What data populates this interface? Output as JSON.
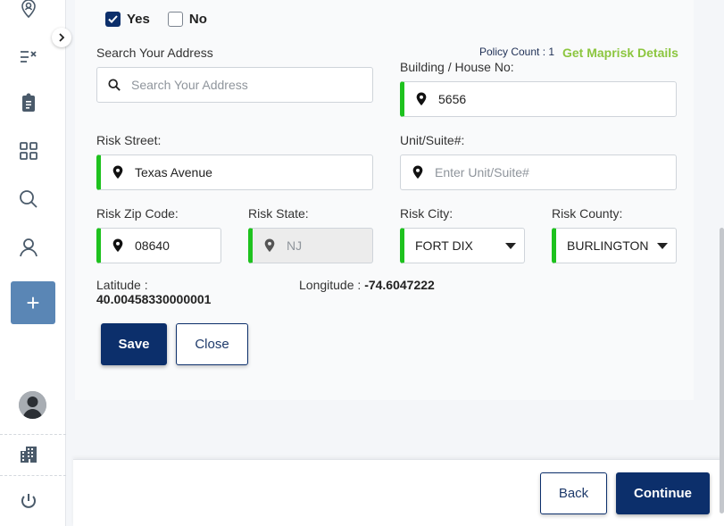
{
  "sidebar": {
    "icons": [
      "location-user-icon",
      "checklist-icon",
      "clipboard-icon",
      "grid-icon",
      "search-icon",
      "user-icon",
      "add-icon",
      "avatar",
      "building-icon",
      "power-icon"
    ]
  },
  "form": {
    "checkbox_yes": {
      "label": "Yes",
      "checked": true
    },
    "checkbox_no": {
      "label": "No",
      "checked": false
    },
    "search_address": {
      "label": "Search Your Address",
      "placeholder": "Search Your Address"
    },
    "policy_count": "Policy Count : 1",
    "maprisk_link": "Get Maprisk Details",
    "building_no": {
      "label": "Building / House No:",
      "value": "5656"
    },
    "risk_street": {
      "label": "Risk Street:",
      "value": "Texas Avenue"
    },
    "unit_suite": {
      "label": "Unit/Suite#:",
      "placeholder": "Enter Unit/Suite#"
    },
    "risk_zip": {
      "label": "Risk Zip Code:",
      "value": "08640"
    },
    "risk_state": {
      "label": "Risk State:",
      "value": "NJ"
    },
    "risk_city": {
      "label": "Risk City:",
      "value": "FORT DIX"
    },
    "risk_county": {
      "label": "Risk County:",
      "value": "BURLINGTON"
    },
    "latitude": {
      "label": "Latitude :",
      "value": "40.00458330000001"
    },
    "longitude": {
      "label": "Longitude :",
      "value": "-74.6047222"
    },
    "save_label": "Save",
    "close_label": "Close"
  },
  "footer": {
    "back_label": "Back",
    "continue_label": "Continue"
  },
  "colors": {
    "primary": "#0c2f6b",
    "accent_green": "#1ec21e",
    "link_green": "#8cc63f",
    "add_button": "#5a86b5"
  }
}
